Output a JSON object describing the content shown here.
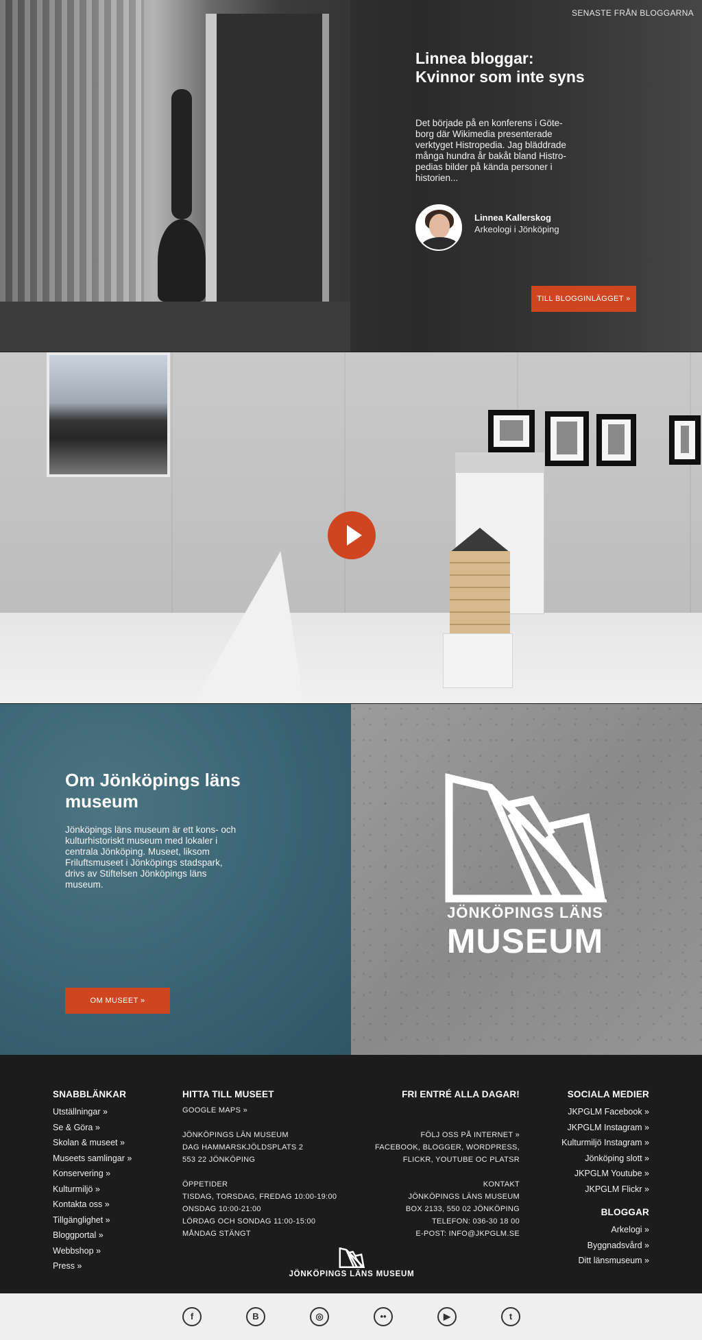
{
  "blog": {
    "kicker": "SENASTE FRÅN BLOGGARNA",
    "title": "Linnea bloggar: Kvinnor som inte syns",
    "excerpt": "Det började på en konferens i Göte-borg där Wikimedia presenterade verktyget Histropedia. Jag bläddrade många hundra år bakåt bland Histro-pedias bilder på kända personer i historien...",
    "author_name": "Linnea Kallerskog",
    "author_role": "Arkeologi i Jönköping",
    "button": "TILL BLOGGINLÄGGET »"
  },
  "video": {
    "play_icon": "play-icon"
  },
  "about": {
    "title": "Om Jönköpings läns museum",
    "text": "Jönköpings läns museum är ett kons- och kulturhistoriskt museum med lokaler i centrala Jönköping. Museet, liksom Friluftsmuseet i Jönköpings stadspark, drivs av Stiftelsen Jönköpings läns museum.",
    "button": "OM MUSEET »",
    "logo_line1": "JÖNKÖPINGS LÄNS",
    "logo_line2": "MUSEUM"
  },
  "footer": {
    "quicklinks": {
      "heading": "SNABBLÄNKAR",
      "links": [
        "Utställningar »",
        "Se & Göra »",
        "Skolan & museet »",
        "Museets samlingar »",
        "Konservering »",
        "Kulturmiljö »",
        "Kontakta oss »",
        "Tillgänglighet »",
        "Bloggportal »",
        "Webbshop »",
        "Press »"
      ]
    },
    "directions": {
      "heading": "HITTA TILL MUSEET",
      "maps": "GOOGLE MAPS »",
      "address": [
        "JÖNKÖPINGS LÄN MUSEUM",
        "DAG HAMMARSKJÖLDSPLATS 2",
        "553 22 JÖNKÖPING"
      ],
      "hours": [
        "ÖPPETIDER",
        "TISDAG, TORSDAG, FREDAG 10:00-19:00",
        "ONSDAG 10:00-21:00",
        "LÖRDAG OCH SONDAG 11:00-15:00",
        "MÅNDAG STÄNGT"
      ]
    },
    "entry": {
      "heading": "FRI ENTRÉ ALLA DAGAR!",
      "follow": [
        "FÖLJ OSS PÅ INTERNET »",
        "FACEBOOK, BLOGGER, WORDPRESS,",
        "FLICKR, YOUTUBE OC PLATSR"
      ],
      "contact": [
        "KONTAKT",
        "JÖNKÖPINGS LÄNS MUSEUM",
        "BOX 2133, 550 02 JÖNKÖPING",
        "TELEFON: 036-30 18 00",
        "E-POST: INFO@JKPGLM.SE"
      ]
    },
    "social": {
      "heading": "SOCIALA MEDIER",
      "links": [
        "JKPGLM Facebook »",
        "JKPGLM Instagram »",
        "Kulturmiljö Instagram »",
        "Jönköping slott »",
        "JKPGLM Youtube »",
        "JKPGLM Flickr »"
      ]
    },
    "blogs": {
      "heading": "BLOGGAR",
      "links": [
        "Arkelogi »",
        "Byggnadsvård »",
        "Ditt länsmuseum »"
      ]
    },
    "logo_text": "JÖNKÖPINGS LÄNS MUSEUM"
  },
  "social_bar": {
    "icons": [
      {
        "name": "facebook-icon",
        "glyph": "f"
      },
      {
        "name": "blogger-icon",
        "glyph": "B"
      },
      {
        "name": "instagram-icon",
        "glyph": "◎"
      },
      {
        "name": "flickr-icon",
        "glyph": "••"
      },
      {
        "name": "youtube-icon",
        "glyph": "▶"
      },
      {
        "name": "tumblr-icon",
        "glyph": "t"
      }
    ]
  },
  "colors": {
    "accent": "#cf4520",
    "teal": "#3d6676",
    "footer_bg": "#1c1c1c",
    "social_bg": "#efefef"
  }
}
